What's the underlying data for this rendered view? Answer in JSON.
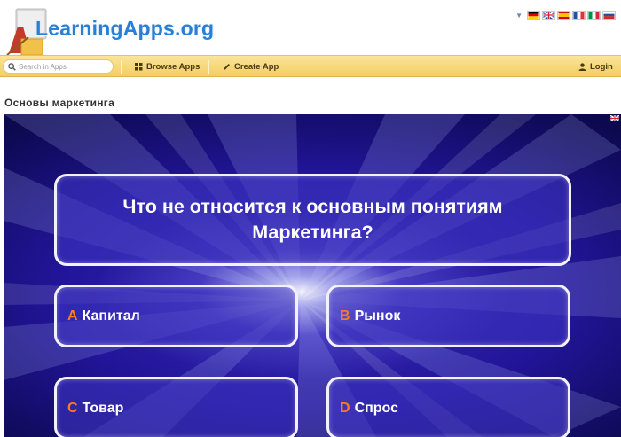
{
  "header": {
    "logo_text": "LearningApps.org"
  },
  "navbar": {
    "search_placeholder": "Search in Apps",
    "browse_label": "Browse Apps",
    "create_label": "Create App",
    "login_label": "Login"
  },
  "page": {
    "title": "Основы маркетинга"
  },
  "quiz": {
    "question": "Что не относится к основным понятиям Маркетинга?",
    "answers": [
      {
        "letter": "A",
        "text": "Капитал"
      },
      {
        "letter": "B",
        "text": "Рынок"
      },
      {
        "letter": "C",
        "text": "Товар"
      },
      {
        "letter": "D",
        "text": "Спрос"
      }
    ]
  },
  "colors": {
    "accent_letter": "#ff7a1f",
    "navbar": "#f2cf62",
    "logo": "#2a7fd4",
    "stage": "#22159a"
  },
  "icons": [
    "logo-icon",
    "search-icon",
    "grid-icon",
    "pencil-icon",
    "user-icon",
    "language-caret-icon",
    "flag-icons"
  ]
}
